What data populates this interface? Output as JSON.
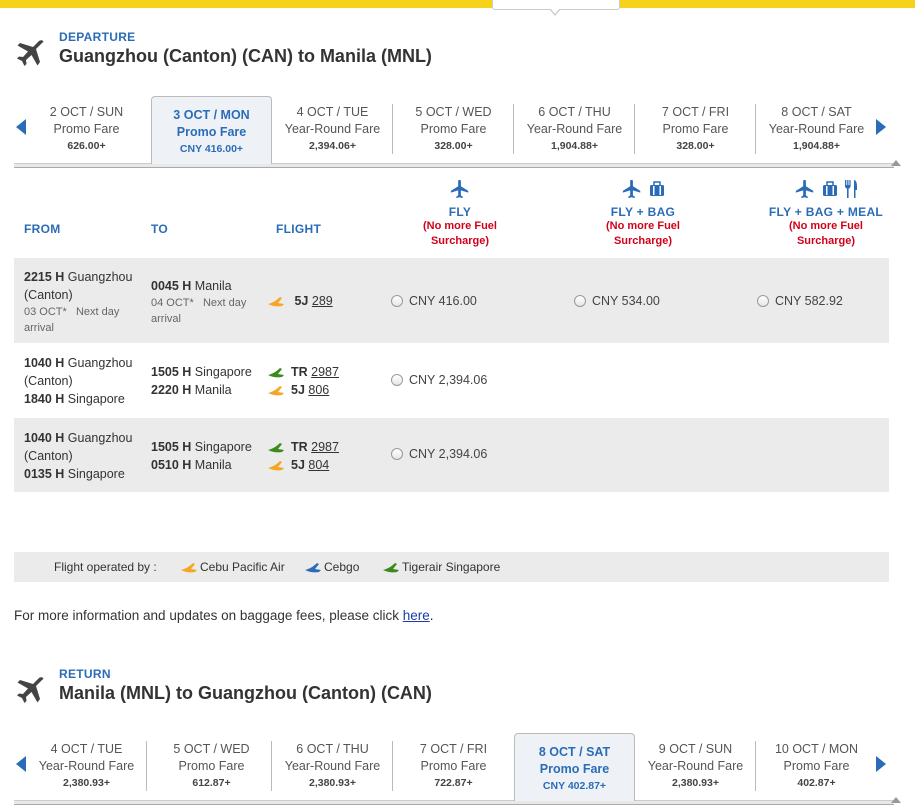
{
  "departure": {
    "label": "DEPARTURE",
    "route": "Guangzhou (Canton)  (CAN)  to  Manila  (MNL)",
    "dates": [
      {
        "date": "2 OCT / SUN",
        "type": "Promo Fare",
        "price": "626.00+"
      },
      {
        "date": "3 OCT / MON",
        "type": "Promo Fare",
        "price": "CNY 416.00+",
        "active": true
      },
      {
        "date": "4 OCT / TUE",
        "type": "Year-Round Fare",
        "price": "2,394.06+"
      },
      {
        "date": "5 OCT / WED",
        "type": "Promo Fare",
        "price": "328.00+"
      },
      {
        "date": "6 OCT / THU",
        "type": "Year-Round Fare",
        "price": "1,904.88+"
      },
      {
        "date": "7 OCT / FRI",
        "type": "Promo Fare",
        "price": "328.00+"
      },
      {
        "date": "8 OCT / SAT",
        "type": "Year-Round Fare",
        "price": "1,904.88+"
      }
    ]
  },
  "table": {
    "headers": {
      "from": "FROM",
      "to": "TO",
      "flight": "FLIGHT"
    },
    "fares": [
      {
        "name": "FLY",
        "note1": "(No more Fuel",
        "note2": "Surcharge)"
      },
      {
        "name": "FLY + BAG",
        "note1": "(No more Fuel",
        "note2": "Surcharge)"
      },
      {
        "name": "FLY + BAG + MEAL",
        "note1": "(No more Fuel",
        "note2": "Surcharge)"
      }
    ],
    "rows": [
      {
        "dep_time": "2215 H",
        "dep_city1": "Guangzhou",
        "dep_city2": "(Canton)",
        "dep_date": "03 OCT*",
        "dep_note1": "Next day",
        "dep_note2": "arrival",
        "arr_time": "0045 H",
        "arr_city": "Manila",
        "arr_date": "04 OCT*",
        "arr_note1": "Next day",
        "arr_note2": "arrival",
        "flight_code": "5J",
        "flight_num": "289",
        "prices": [
          "CNY 416.00",
          "CNY 534.00",
          "CNY 582.92"
        ]
      },
      {
        "dep_time": "1040 H",
        "dep_city1": "Guangzhou",
        "dep_city2": "(Canton)",
        "leg2_time": "1840 H",
        "leg2_city": "Singapore",
        "arr_time": "1505 H",
        "arr_city": "Singapore",
        "arr2_time": "2220 H",
        "arr2_city": "Manila",
        "flight_code": "TR",
        "flight_num": "2987",
        "flight2_code": "5J",
        "flight2_num": "806",
        "prices": [
          "CNY 2,394.06"
        ]
      },
      {
        "dep_time": "1040 H",
        "dep_city1": "Guangzhou",
        "dep_city2": "(Canton)",
        "leg2_time": "0135 H",
        "leg2_city": "Singapore",
        "arr_time": "1505 H",
        "arr_city": "Singapore",
        "arr2_time": "0510 H",
        "arr2_city": "Manila",
        "flight_code": "TR",
        "flight_num": "2987",
        "flight2_code": "5J",
        "flight2_num": "804",
        "prices": [
          "CNY 2,394.06"
        ]
      }
    ]
  },
  "legend": {
    "label": "Flight operated by :",
    "items": [
      "Cebu Pacific Air",
      "Cebgo",
      "Tigerair Singapore"
    ]
  },
  "info": {
    "text": "For more information and updates on baggage fees, please click ",
    "link": "here",
    "end": "."
  },
  "return": {
    "label": "RETURN",
    "route": "Manila  (MNL) to  Guangzhou (Canton)  (CAN)",
    "dates": [
      {
        "date": "4 OCT / TUE",
        "type": "Year-Round Fare",
        "price": "2,380.93+"
      },
      {
        "date": "5 OCT / WED",
        "type": "Promo Fare",
        "price": "612.87+"
      },
      {
        "date": "6 OCT / THU",
        "type": "Year-Round Fare",
        "price": "2,380.93+"
      },
      {
        "date": "7 OCT / FRI",
        "type": "Promo Fare",
        "price": "722.87+"
      },
      {
        "date": "8 OCT / SAT",
        "type": "Promo Fare",
        "price": "CNY 402.87+",
        "active": true
      },
      {
        "date": "9 OCT / SUN",
        "type": "Year-Round Fare",
        "price": "2,380.93+"
      },
      {
        "date": "10 OCT / MON",
        "type": "Promo Fare",
        "price": "402.87+"
      }
    ]
  },
  "colors": {
    "accent": "#2b6cb8",
    "surcharge": "#d0021b",
    "topbar": "#f7d21a",
    "cebu": "#f5a623",
    "cebgo": "#2b6cb8",
    "tigerair": "#3a8a1c"
  }
}
